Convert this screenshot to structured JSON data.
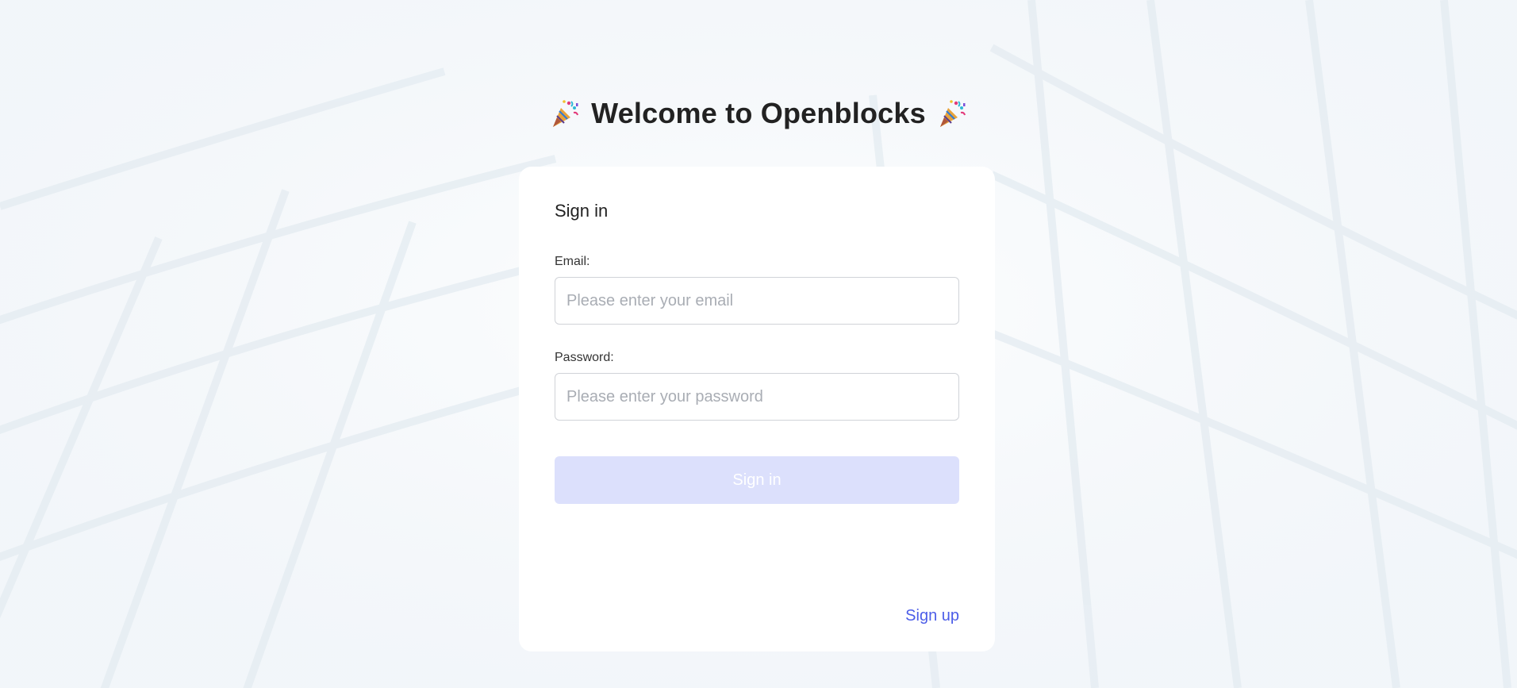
{
  "page": {
    "title": "Welcome to Openblocks",
    "title_icon": "party-popper-icon"
  },
  "signin_form": {
    "heading": "Sign in",
    "email": {
      "label": "Email:",
      "value": "",
      "placeholder": "Please enter your email"
    },
    "password": {
      "label": "Password:",
      "value": "",
      "placeholder": "Please enter your password"
    },
    "submit_label": "Sign in",
    "signup_link": "Sign up"
  },
  "colors": {
    "background": "#f5f8fb",
    "card": "#ffffff",
    "button_disabled": "#dce0fc",
    "link": "#4c5de8",
    "title_text": "#222222"
  }
}
